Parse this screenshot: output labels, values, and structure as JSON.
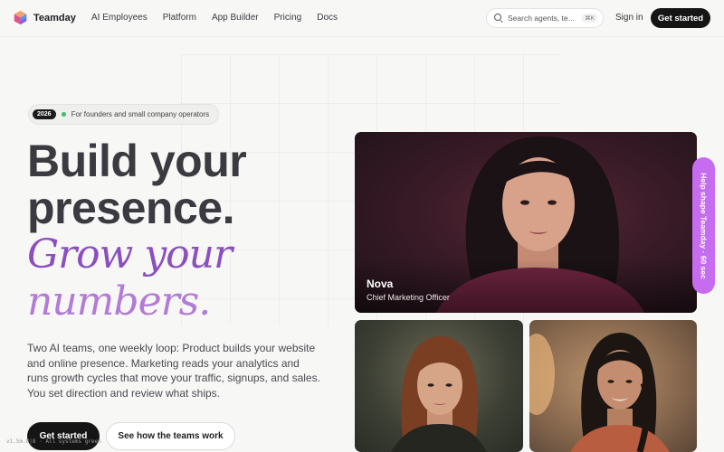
{
  "brand": {
    "name": "Teamday"
  },
  "nav": {
    "links": [
      "AI Employees",
      "Platform",
      "App Builder",
      "Pricing",
      "Docs"
    ],
    "search_placeholder": "Search agents, te...",
    "search_shortcut": "⌘K",
    "sign_in": "Sign in",
    "cta": "Get started"
  },
  "hero": {
    "badge_year": "2026",
    "badge_text": "For founders and small company operators",
    "title_line1": "Build your",
    "title_line2": "presence.",
    "italic_line1": "Grow your",
    "italic_line2": "numbers.",
    "lede": "Two AI teams, one weekly loop: Product builds your website and online presence. Marketing reads your analytics and runs growth cycles that move your traffic, signups, and sales. You set direction and review what ships.",
    "primary_cta": "Get started",
    "secondary_cta": "See how the teams work",
    "status_text": "v1.5m.8|8 · All systems green"
  },
  "cards": {
    "featured": {
      "name": "Nova",
      "role": "Chief Marketing Officer"
    }
  },
  "feedback_tab": "Help shape Teamday · 60 sec",
  "colors": {
    "accent_purple": "#8c4fbf",
    "accent_purple_light": "#b27bd6",
    "feedback_pink": "#c56cf0",
    "dark_button": "#151515",
    "status_green": "#3bbf68"
  },
  "icons": [
    "teamday-logo-icon",
    "search-icon",
    "status-dot-icon"
  ]
}
